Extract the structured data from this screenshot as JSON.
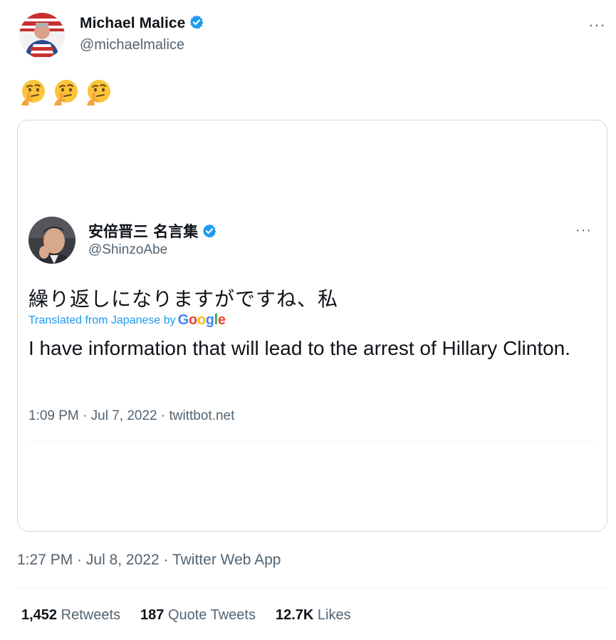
{
  "tweet": {
    "author_name": "Michael Malice",
    "handle": "@michaelmalice",
    "more": "···",
    "timestamp": "1:27 PM",
    "date": "Jul 8, 2022",
    "source": "Twitter Web App",
    "separator": "·"
  },
  "quoted": {
    "author_name": "安倍晋三 名言集",
    "handle": "@ShinzoAbe",
    "more": "···",
    "japanese_text": "繰り返しになりますがですね、私",
    "translated_prefix": "Translated from Japanese by",
    "translated_brand": "Google",
    "translation": "I have information that will lead to the arrest of Hillary Clinton.",
    "timestamp": "1:09 PM",
    "date": "Jul 7, 2022",
    "source": "twittbot.net",
    "separator": "·"
  },
  "stats": {
    "retweets_count": "1,452",
    "retweets_label": "Retweets",
    "quotes_count": "187",
    "quotes_label": "Quote Tweets",
    "likes_count": "12.7K",
    "likes_label": "Likes"
  },
  "colors": {
    "verified": "#1d9bf0",
    "secondary_text": "#536471",
    "google_blue": "#4285f4",
    "google_red": "#ea4335",
    "google_yellow": "#fbbc05",
    "google_green": "#34a853"
  }
}
